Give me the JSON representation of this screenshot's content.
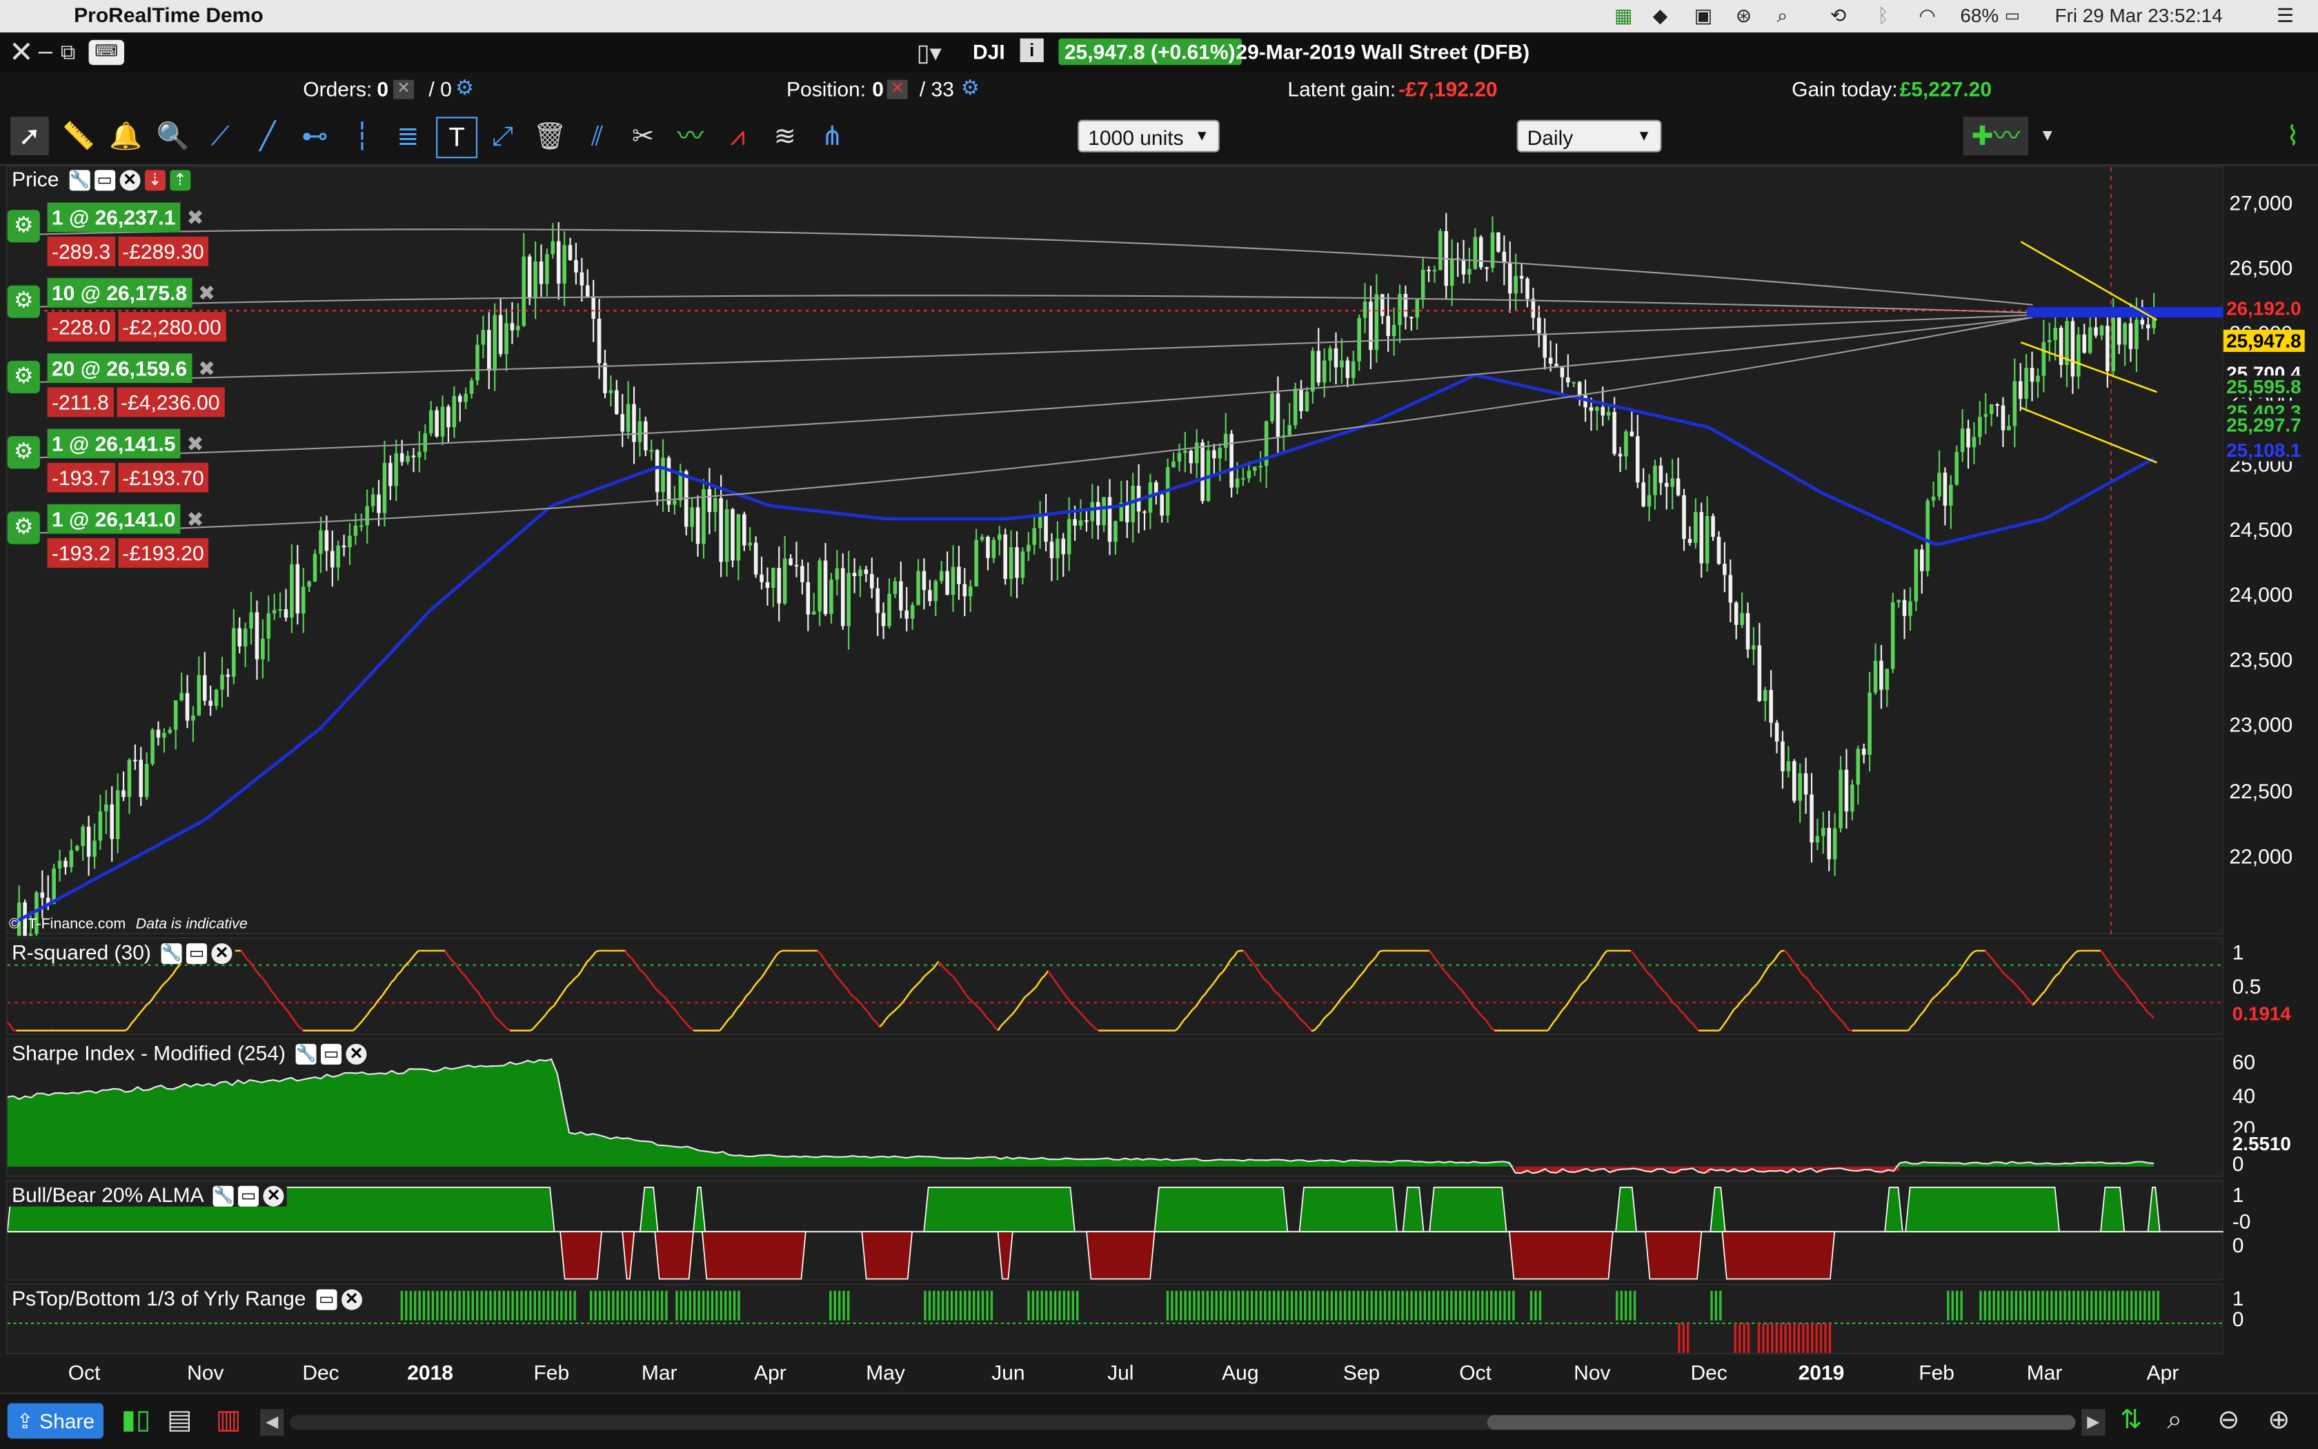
{
  "menubar": {
    "app_name": "ProRealTime Demo",
    "battery": "68%",
    "clock": "Fri 29 Mar  23:52:14"
  },
  "window": {
    "symbol": "DJI",
    "price_change": "25,947.8 (+0.61%)",
    "instrument": "29-Mar-2019 Wall Street (DFB)"
  },
  "orders_bar": {
    "orders_label": "Orders:",
    "orders_count": "0",
    "orders_total": "/ 0",
    "position_label": "Position:",
    "position_count": "0",
    "position_total": "/ 33",
    "latent_label": "Latent gain:",
    "latent_value": "-£7,192.20",
    "today_label": "Gain today:",
    "today_value": "£5,227.20"
  },
  "toolbar": {
    "units": "1000 units",
    "timeframe": "Daily"
  },
  "price_panel": {
    "label": "Price",
    "copyright": "© IT-Finance.com",
    "disclaimer": "Data is indicative",
    "y_ticks": [
      "27,000",
      "26,500",
      "26,000",
      "25,500",
      "25,000",
      "24,500",
      "24,000",
      "23,500",
      "23,000",
      "22,500",
      "22,000"
    ],
    "price_tags": [
      {
        "text": "26,192.0",
        "color": "#ff2d2d",
        "bg": "#1b1b1b"
      },
      {
        "text": "25,947.8",
        "color": "#000000",
        "bg": "#ffd400"
      },
      {
        "text": "25,700.4",
        "color": "#ffffff",
        "bg": "#1b1b1b"
      },
      {
        "text": "25,595.8",
        "color": "#3bd13b",
        "bg": "#1b1b1b"
      },
      {
        "text": "25,402.3",
        "color": "#3bd13b",
        "bg": "#1b1b1b"
      },
      {
        "text": "25,297.7",
        "color": "#3bd13b",
        "bg": "#1b1b1b"
      },
      {
        "text": "25,108.1",
        "color": "#2a3bff",
        "bg": "#1b1b1b"
      }
    ],
    "orders": [
      {
        "title": "1 @ 26,237.1",
        "points": "-289.3",
        "money": "-£289.30"
      },
      {
        "title": "10 @ 26,175.8",
        "points": "-228.0",
        "money": "-£2,280.00"
      },
      {
        "title": "20 @ 26,159.6",
        "points": "-211.8",
        "money": "-£4,236.00"
      },
      {
        "title": "1 @ 26,141.5",
        "points": "-193.7",
        "money": "-£193.70"
      },
      {
        "title": "1 @ 26,141.0",
        "points": "-193.2",
        "money": "-£193.20"
      }
    ]
  },
  "rsquared": {
    "label": "R-squared (30)",
    "ticks": [
      "1",
      "0.5"
    ],
    "value": "0.1914"
  },
  "sharpe": {
    "label": "Sharpe Index - Modified (254)",
    "ticks": [
      "60",
      "40",
      "20",
      "0"
    ],
    "value": "2.5510"
  },
  "bullbear": {
    "label": "Bull/Bear 20% ALMA",
    "ticks": [
      "1",
      "-0",
      "0"
    ]
  },
  "pstop": {
    "label": "PsTop/Bottom 1/3 of Yrly Range",
    "ticks": [
      "1",
      "0"
    ]
  },
  "x_axis": [
    "Oct",
    "Nov",
    "Dec",
    "2018",
    "Feb",
    "Mar",
    "Apr",
    "May",
    "Jun",
    "Jul",
    "Aug",
    "Sep",
    "Oct",
    "Nov",
    "Dec",
    "2019",
    "Feb",
    "Mar",
    "Apr"
  ],
  "bottom": {
    "share_label": "Share"
  },
  "chart_data": {
    "type": "candlestick",
    "ylim": [
      21500,
      27200
    ],
    "x": [
      "Oct",
      "Nov",
      "Dec",
      "2018",
      "Feb",
      "Mar",
      "Apr",
      "May",
      "Jun",
      "Jul",
      "Aug",
      "Sep",
      "Oct",
      "Nov",
      "Dec",
      "2019",
      "Feb",
      "Mar",
      "Apr"
    ],
    "series": [
      {
        "values": [
          22100,
          23300,
          24300,
          25200,
          26700,
          24900,
          24200,
          23900,
          24300,
          24700,
          25100,
          26000,
          26800,
          25300,
          24400,
          22000,
          24800,
          25900,
          25950
        ]
      },
      {
        "values": [
          21800,
          22300,
          23000,
          23900,
          24700,
          25000,
          24700,
          24600,
          24600,
          24700,
          25000,
          25300,
          25700,
          25500,
          25300,
          24800,
          24400,
          24600,
          25100
        ]
      }
    ],
    "rsquared": {
      "ylim": [
        0,
        1
      ],
      "current": 0.1914
    },
    "sharpe": {
      "ylim": [
        0,
        70
      ],
      "current": 2.551
    }
  }
}
